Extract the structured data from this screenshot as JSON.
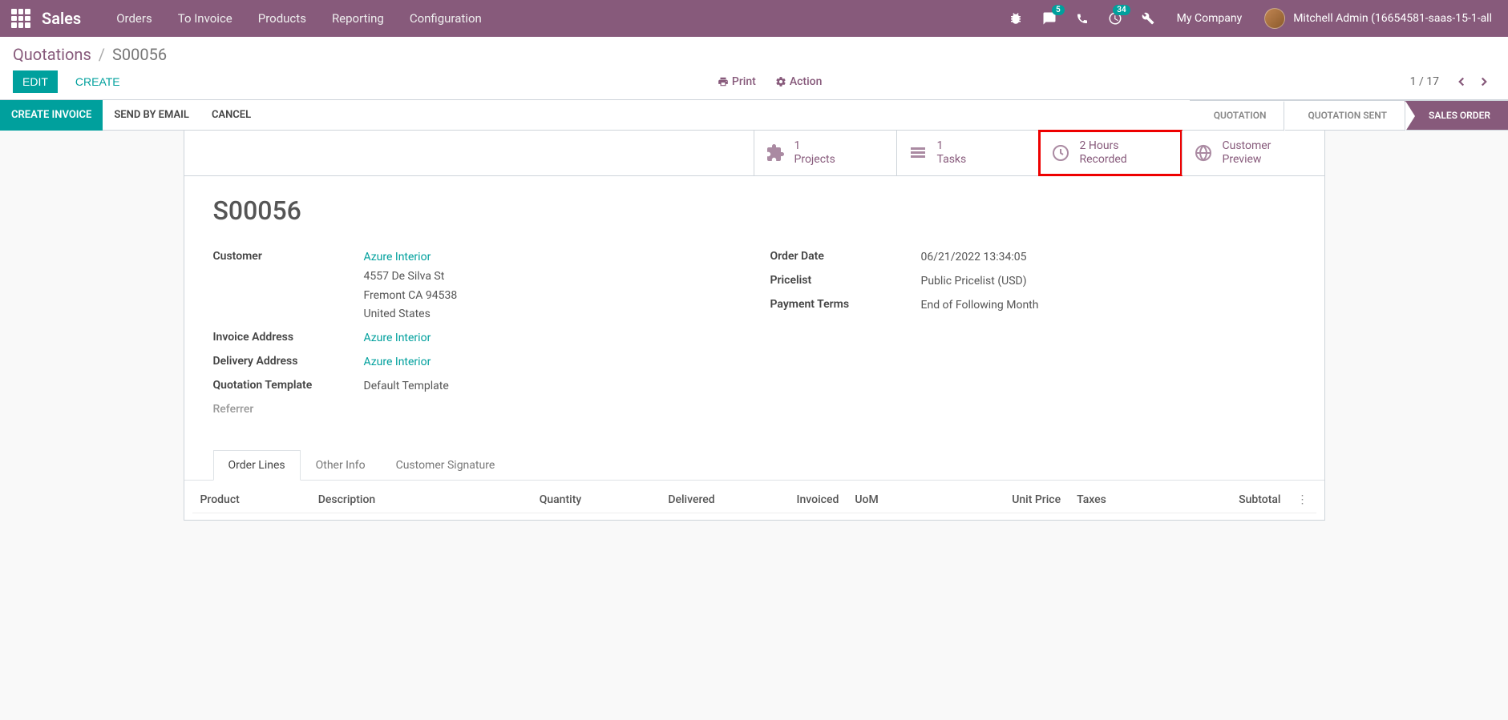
{
  "navbar": {
    "brand": "Sales",
    "menu": [
      "Orders",
      "To Invoice",
      "Products",
      "Reporting",
      "Configuration"
    ],
    "messages_badge": "5",
    "activities_badge": "34",
    "company": "My Company",
    "user": "Mitchell Admin (16654581-saas-15-1-all"
  },
  "breadcrumb": {
    "root": "Quotations",
    "current": "S00056"
  },
  "cp": {
    "edit": "EDIT",
    "create": "CREATE",
    "print": "Print",
    "action": "Action",
    "pager": "1 / 17"
  },
  "statusbar": {
    "create_invoice": "CREATE INVOICE",
    "send_email": "SEND BY EMAIL",
    "cancel": "CANCEL",
    "steps": {
      "quotation": "QUOTATION",
      "sent": "QUOTATION SENT",
      "order": "SALES ORDER"
    }
  },
  "stat_buttons": {
    "projects": {
      "count": "1",
      "label": "Projects"
    },
    "tasks": {
      "count": "1",
      "label": "Tasks"
    },
    "hours": {
      "count": "2 Hours",
      "label": "Recorded"
    },
    "preview": {
      "count": "Customer",
      "label": "Preview"
    }
  },
  "record": {
    "name": "S00056",
    "left": {
      "customer_label": "Customer",
      "customer_name": "Azure Interior",
      "customer_addr1": "4557 De Silva St",
      "customer_addr2": "Fremont CA 94538",
      "customer_addr3": "United States",
      "invoice_addr_label": "Invoice Address",
      "invoice_addr": "Azure Interior",
      "delivery_addr_label": "Delivery Address",
      "delivery_addr": "Azure Interior",
      "template_label": "Quotation Template",
      "template": "Default Template",
      "referrer_label": "Referrer"
    },
    "right": {
      "order_date_label": "Order Date",
      "order_date": "06/21/2022 13:34:05",
      "pricelist_label": "Pricelist",
      "pricelist": "Public Pricelist (USD)",
      "terms_label": "Payment Terms",
      "terms": "End of Following Month"
    }
  },
  "tabs": {
    "lines": "Order Lines",
    "other": "Other Info",
    "sign": "Customer Signature"
  },
  "columns": {
    "product": "Product",
    "description": "Description",
    "quantity": "Quantity",
    "delivered": "Delivered",
    "invoiced": "Invoiced",
    "uom": "UoM",
    "unit_price": "Unit Price",
    "taxes": "Taxes",
    "subtotal": "Subtotal"
  }
}
